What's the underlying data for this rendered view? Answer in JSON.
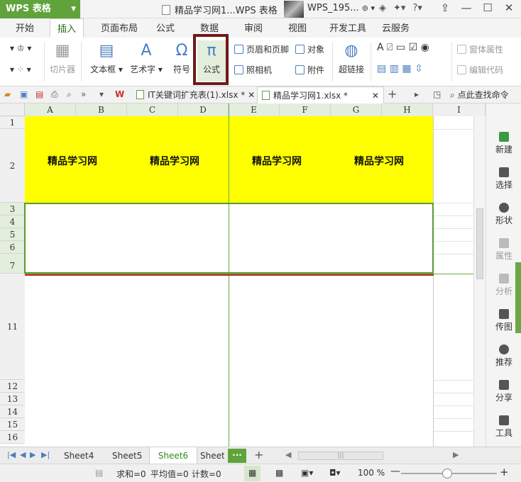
{
  "app": {
    "name": "WPS 表格",
    "doc_title": "精品学习网1...WPS 表格",
    "user": "WPS_195..."
  },
  "ribbon_tabs": [
    "开始",
    "插入",
    "页面布局",
    "公式",
    "数据",
    "审阅",
    "视图",
    "开发工具",
    "云服务"
  ],
  "ribbon": {
    "slicer": "切片器",
    "textbox": "文本框",
    "wordart": "艺术字",
    "symbol": "符号",
    "formula": "公式",
    "header_footer": "页眉和页脚",
    "object": "对象",
    "camera": "照相机",
    "attachment": "附件",
    "hyperlink": "超链接",
    "form_props": "窗体属性",
    "edit_code": "编辑代码"
  },
  "doc_tabs": [
    {
      "label": "IT关键词扩充表(1).xlsx *"
    },
    {
      "label": "精品学习网1.xlsx *"
    }
  ],
  "find_command": "点此查找命令",
  "columns": [
    "A",
    "B",
    "C",
    "D",
    "E",
    "F",
    "G",
    "H",
    "I"
  ],
  "rows": [
    "1",
    "2",
    "3",
    "4",
    "5",
    "6",
    "7",
    "11",
    "12",
    "13",
    "14",
    "15",
    "16"
  ],
  "cells": {
    "b2": "精品学习网",
    "d2": "精品学习网",
    "f2": "精品学习网",
    "h2": "精品学习网"
  },
  "side_panel": [
    "新建",
    "选择",
    "形状",
    "属性",
    "分析",
    "传图",
    "推荐",
    "分享",
    "工具"
  ],
  "sheets": [
    "Sheet4",
    "Sheet5",
    "Sheet6",
    "Sheet"
  ],
  "active_sheet": "Sheet6",
  "status": {
    "sum": "求和=0",
    "avg": "平均值=0",
    "count": "计数=0",
    "zoom": "100 %"
  },
  "colors": {
    "accent_green": "#5fa33a",
    "highlight_fill": "#ffff00",
    "formula_box": "#6e1a1a"
  }
}
